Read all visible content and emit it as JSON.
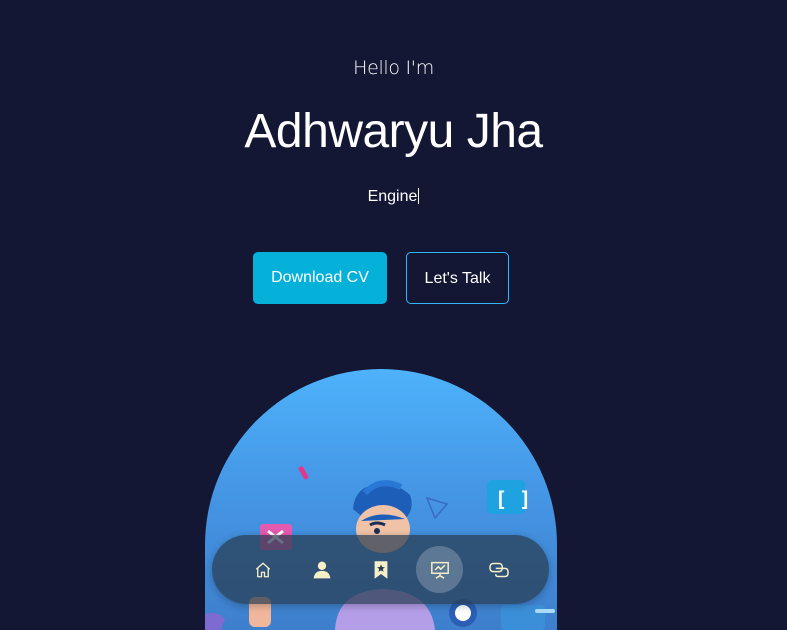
{
  "hero": {
    "greeting": "Hello I'm",
    "name": "Adhwaryu Jha",
    "typed_role": "Engine",
    "buttons": {
      "download_cv": "Download CV",
      "lets_talk": "Let's Talk"
    }
  },
  "colors": {
    "background": "#131733",
    "primary_button": "#06b1d9",
    "outline_button_border": "#32b6ff",
    "dock_icon": "#f5f0c8"
  },
  "dock": {
    "items": [
      {
        "icon": "home-icon",
        "active": false
      },
      {
        "icon": "user-icon",
        "active": false
      },
      {
        "icon": "bookmark-icon",
        "active": false
      },
      {
        "icon": "presentation-icon",
        "active": true
      },
      {
        "icon": "chat-icon",
        "active": false
      }
    ]
  }
}
